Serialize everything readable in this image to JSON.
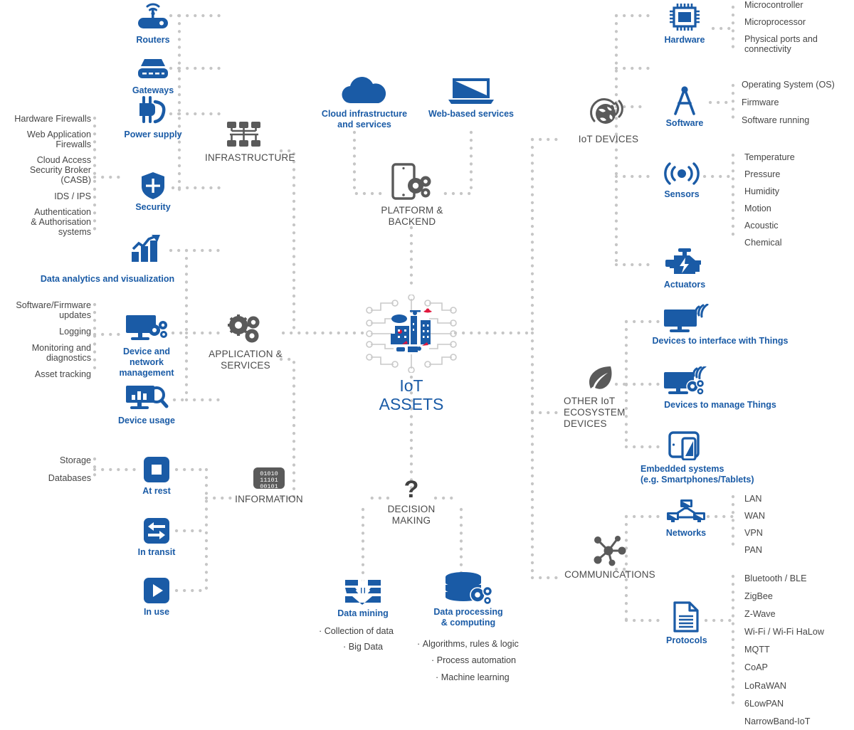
{
  "center": {
    "title": "IoT\nASSETS",
    "icon": "smart-city-circuit-icon"
  },
  "colors": {
    "blue": "#1a5ba6",
    "blue_dark": "#13508f",
    "grey_text": "#464646",
    "grey_icon": "#5a5a5a",
    "dot": "#c6c6c6"
  },
  "categories": [
    {
      "key": "infrastructure",
      "label": "INFRASTRUCTURE",
      "icon": "network-rack-icon"
    },
    {
      "key": "application_services",
      "label": "APPLICATION &\nSERVICES",
      "icon": "gears-icon"
    },
    {
      "key": "information",
      "label": "INFORMATION",
      "icon": "binary-data-icon",
      "icon_text": "01010\n11101\n00101"
    },
    {
      "key": "platform_backend",
      "label": "PLATFORM &\nBACKEND",
      "icon": "tablet-gears-icon"
    },
    {
      "key": "decision_making",
      "label": "DECISION\nMAKING",
      "icon": "question-mark-icon"
    },
    {
      "key": "iot_devices",
      "label": "IoT DEVICES",
      "icon": "globe-signal-icon"
    },
    {
      "key": "other_iot_ecosystem_devices",
      "label": "OTHER IoT\nECOSYSTEM\nDEVICES",
      "icon": "leaf-icon"
    },
    {
      "key": "communications",
      "label": "COMMUNICATIONS",
      "icon": "network-hub-icon"
    }
  ],
  "infrastructure_nodes": [
    {
      "label": "Routers",
      "icon": "router-icon",
      "leaves": []
    },
    {
      "label": "Gateways",
      "icon": "gateway-icon",
      "leaves": []
    },
    {
      "label": "Power supply",
      "icon": "power-plug-icon",
      "leaves": []
    },
    {
      "label": "Security",
      "icon": "shield-icon",
      "leaves": [
        "Hardware Firewalls",
        "Web Application\nFirewalls",
        "Cloud Access\nSecurity Broker\n(CASB)",
        "IDS / IPS",
        "Authentication\n& Authorisation\nsystems"
      ]
    }
  ],
  "application_nodes": [
    {
      "label": "Data analytics and visualization",
      "icon": "bar-chart-arrow-icon",
      "leaves": []
    },
    {
      "label": "Device and\nnetwork\nmanagement",
      "icon": "monitor-gears-icon",
      "leaves": [
        "Software/Firmware\nupdates",
        "Logging",
        "Monitoring and\ndiagnostics",
        "Asset tracking"
      ]
    },
    {
      "label": "Device usage",
      "icon": "monitor-chart-search-icon",
      "leaves": []
    }
  ],
  "information_nodes": [
    {
      "label": "At rest",
      "icon": "stop-square-icon",
      "leaves": [
        "Storage",
        "Databases"
      ]
    },
    {
      "label": "In transit",
      "icon": "transfer-arrows-icon",
      "leaves": []
    },
    {
      "label": "In use",
      "icon": "play-icon",
      "leaves": []
    }
  ],
  "platform_nodes": [
    {
      "label": "Cloud infrastructure\nand services",
      "icon": "cloud-icon"
    },
    {
      "label": "Web-based services",
      "icon": "laptop-icon"
    }
  ],
  "decision_nodes": [
    {
      "label": "Data mining",
      "icon": "data-mining-icon",
      "bullets": [
        "Collection of data",
        "Big Data"
      ]
    },
    {
      "label": "Data processing\n& computing",
      "icon": "database-gears-icon",
      "bullets": [
        "Algorithms, rules & logic",
        "Process automation",
        "Machine learning"
      ]
    }
  ],
  "iot_device_nodes": [
    {
      "label": "Hardware",
      "icon": "chip-icon",
      "leaves": [
        "Microcontroller",
        "Microprocessor",
        "Physical ports and\nconnectivity"
      ]
    },
    {
      "label": "Software",
      "icon": "compass-icon",
      "leaves": [
        "Operating System (OS)",
        "Firmware",
        "Software running"
      ]
    },
    {
      "label": "Sensors",
      "icon": "sensor-waves-icon",
      "leaves": [
        "Temperature",
        "Pressure",
        "Humidity",
        "Motion",
        "Acoustic",
        "Chemical"
      ]
    },
    {
      "label": "Actuators",
      "icon": "engine-bolt-icon",
      "leaves": []
    }
  ],
  "other_device_nodes": [
    {
      "label": "Devices to interface with Things",
      "icon": "monitor-wifi-icon",
      "leaves": []
    },
    {
      "label": "Devices to manage Things",
      "icon": "monitor-wifi-gears-icon",
      "leaves": []
    },
    {
      "label": "Embedded systems\n(e.g. Smartphones/Tablets)",
      "icon": "tablet-phone-icon",
      "leaves": []
    }
  ],
  "communication_nodes": [
    {
      "label": "Networks",
      "icon": "network-topology-icon",
      "leaves": [
        "LAN",
        "WAN",
        "VPN",
        "PAN"
      ]
    },
    {
      "label": "Protocols",
      "icon": "document-lines-icon",
      "leaves": [
        "Bluetooth / BLE",
        "ZigBee",
        "Z-Wave",
        "Wi-Fi / Wi-Fi HaLow",
        "MQTT",
        "CoAP",
        "LoRaWAN",
        "6LowPAN",
        "NarrowBand-IoT"
      ]
    }
  ]
}
